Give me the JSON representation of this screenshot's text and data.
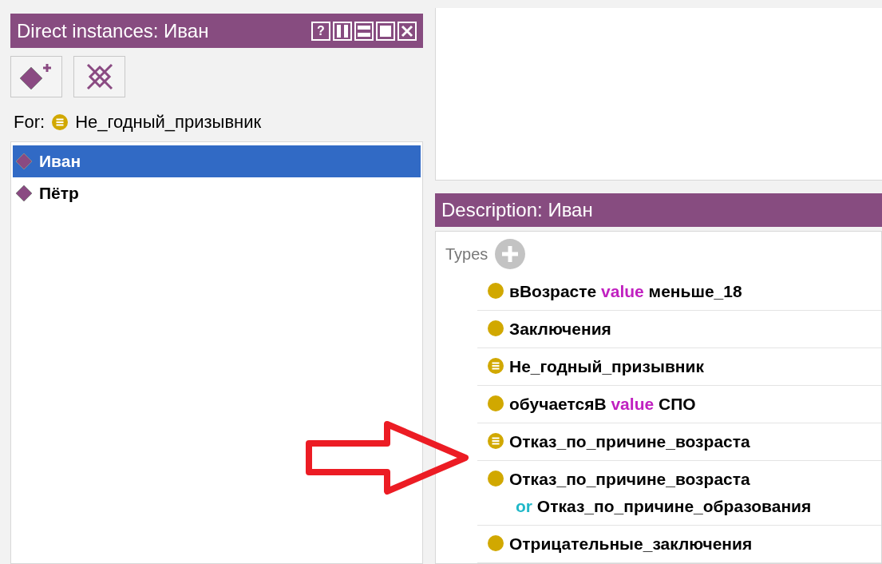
{
  "instances_panel": {
    "title": "Direct instances: Иван",
    "help_button": "?",
    "for_label": "For:",
    "for_class": "Не_годный_призывник",
    "individuals": [
      {
        "name": "Иван",
        "selected": true
      },
      {
        "name": "Пётр",
        "selected": false
      }
    ]
  },
  "description_panel": {
    "title": "Description: Иван",
    "section": "Types",
    "types": [
      {
        "kind": "restriction",
        "lines": [
          [
            {
              "text": "вВозрасте",
              "kind": "name"
            },
            {
              "text": "value",
              "kind": "keyword"
            },
            {
              "text": "меньше_18",
              "kind": "name"
            }
          ]
        ]
      },
      {
        "kind": "restriction",
        "lines": [
          [
            {
              "text": "Заключения",
              "kind": "name"
            }
          ]
        ]
      },
      {
        "kind": "defined",
        "lines": [
          [
            {
              "text": "Не_годный_призывник",
              "kind": "name"
            }
          ]
        ]
      },
      {
        "kind": "restriction",
        "lines": [
          [
            {
              "text": "обучаетсяВ",
              "kind": "name"
            },
            {
              "text": "value",
              "kind": "keyword"
            },
            {
              "text": "СПО",
              "kind": "name"
            }
          ]
        ]
      },
      {
        "kind": "defined",
        "lines": [
          [
            {
              "text": "Отказ_по_причине_возраста",
              "kind": "name"
            }
          ]
        ]
      },
      {
        "kind": "restriction",
        "lines": [
          [
            {
              "text": "Отказ_по_причине_возраста",
              "kind": "name"
            }
          ],
          [
            {
              "text": "or",
              "kind": "connective"
            },
            {
              "text": "Отказ_по_причине_образования",
              "kind": "name"
            }
          ]
        ]
      },
      {
        "kind": "restriction",
        "lines": [
          [
            {
              "text": "Отрицательные_заключения",
              "kind": "name"
            }
          ]
        ]
      }
    ]
  }
}
